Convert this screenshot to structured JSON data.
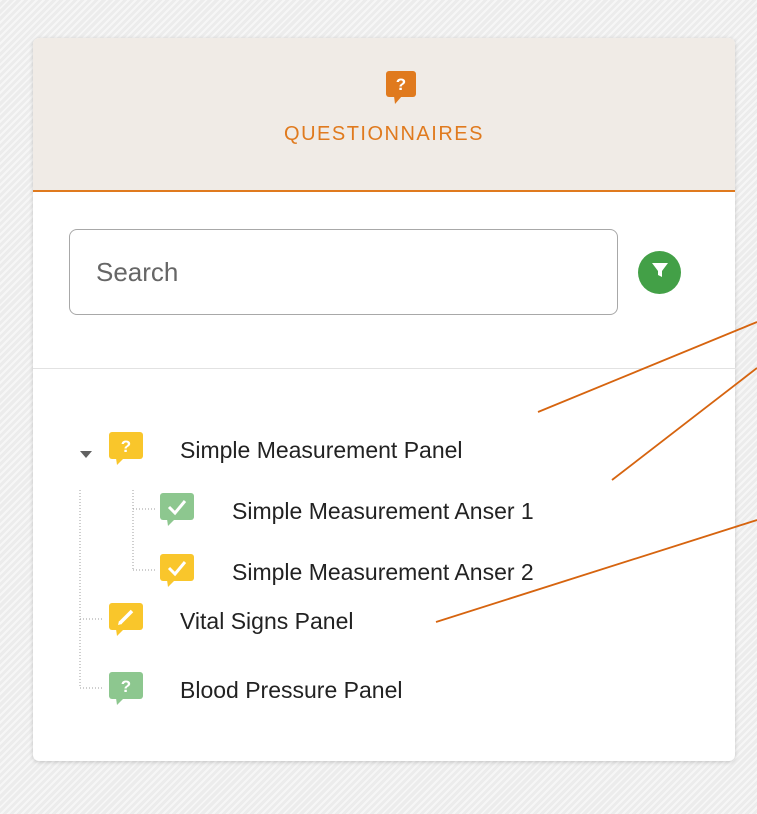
{
  "header": {
    "title": "QUESTIONNAIRES",
    "icon": "question-bubble-icon",
    "title_color": "#e07a1e"
  },
  "search": {
    "placeholder": "Search",
    "value": ""
  },
  "filter": {
    "icon": "filter-icon",
    "color": "#43a047"
  },
  "tree": {
    "items": [
      {
        "label": "Simple Measurement Panel",
        "icon": "question-bubble-icon",
        "color": "#f9c62b",
        "expanded": true
      },
      {
        "label": "Simple Measurement Anser 1",
        "icon": "check-bubble-icon",
        "color": "#8dc78f"
      },
      {
        "label": "Simple Measurement Anser 2",
        "icon": "check-bubble-icon",
        "color": "#f9c62b"
      },
      {
        "label": "Vital Signs Panel",
        "icon": "pencil-bubble-icon",
        "color": "#f9c62b"
      },
      {
        "label": "Blood Pressure Panel",
        "icon": "question-bubble-icon",
        "color": "#8dc78f"
      }
    ]
  },
  "colors": {
    "accent": "#e07a1e",
    "header_bg": "#f0ebe6",
    "annotation_lines": "#d6640f"
  }
}
